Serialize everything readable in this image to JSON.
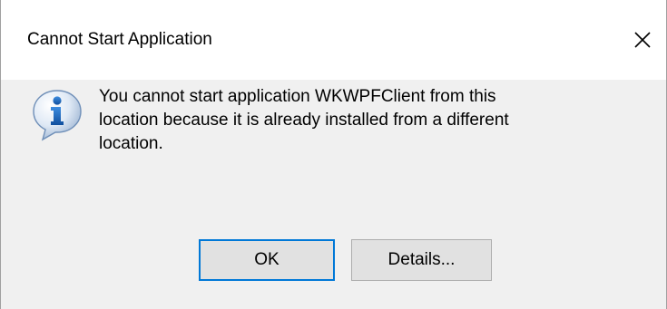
{
  "dialog": {
    "title": "Cannot Start Application",
    "message_lines": [
      "You cannot start application WKWPFClient from this",
      "location because it is already installed from a different",
      "location."
    ],
    "buttons": {
      "ok_label": "OK",
      "details_label": "Details..."
    }
  },
  "icons": {
    "close": "close-icon",
    "info": "information-icon"
  },
  "colors": {
    "title_bar_bg": "#ffffff",
    "body_bg": "#f0f0f0",
    "default_button_border": "#0078d7",
    "button_bg": "#e1e1e1",
    "info_icon_blue": "#1e6fc4"
  }
}
